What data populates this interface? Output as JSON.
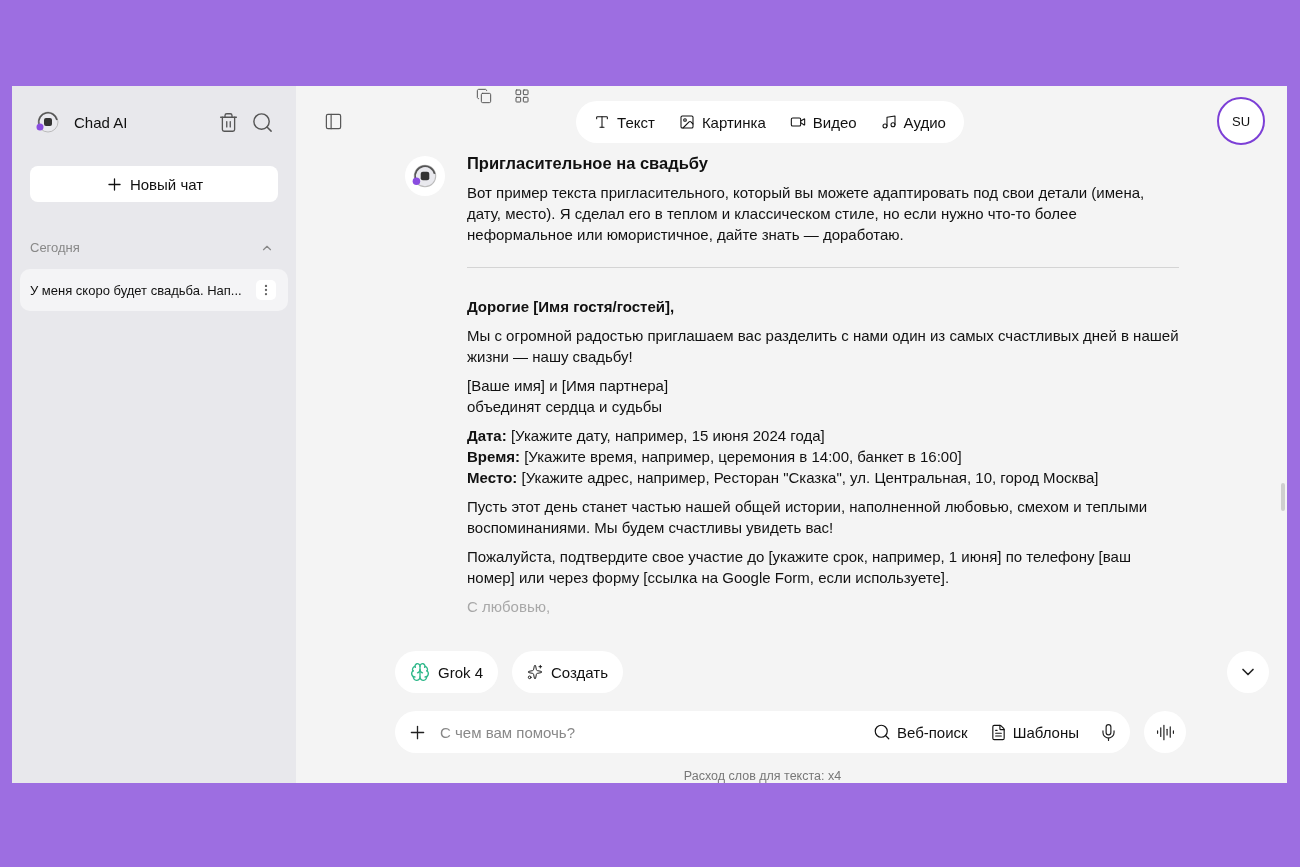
{
  "sidebar": {
    "brand": "Chad AI",
    "new_chat": "Новый чат",
    "section": {
      "title": "Сегодня",
      "expanded": true
    },
    "chats": [
      {
        "title": "У меня скоро будет свадьба. Нап...",
        "selected": true
      }
    ]
  },
  "mode_tabs": [
    {
      "label": "Текст",
      "kind": "text"
    },
    {
      "label": "Картинка",
      "kind": "image"
    },
    {
      "label": "Видео",
      "kind": "video"
    },
    {
      "label": "Аудио",
      "kind": "audio"
    }
  ],
  "avatar": "SU",
  "message": {
    "title": "Пригласительное на свадьбу",
    "intro": "Вот пример текста пригласительного, который вы можете адаптировать под свои детали (имена, дату, место). Я сделал его в теплом и классическом стиле, но если нужно что-то более неформальное или юмористичное, дайте знать — доработаю.",
    "blocks": [
      {
        "kind": "greeting",
        "lines": [
          "Дорогие [Имя гостя/гостей],"
        ]
      },
      {
        "kind": "text",
        "lines": [
          "Мы с огромной радостью приглашаем вас разделить с нами один из самых счастливых дней в нашей жизни — нашу свадьбу!"
        ]
      },
      {
        "kind": "text",
        "lines": [
          "[Ваше имя] и [Имя партнера]",
          "объединят сердца и судьбы"
        ]
      },
      {
        "kind": "text",
        "lines": [
          "**Дата:** [Укажите дату, например, 15 июня 2024 года]",
          "**Время:** [Укажите время, например, церемония в 14:00, банкет в 16:00]",
          "**Место:** [Укажите адрес, например, Ресторан \"Сказка\", ул. Центральная, 10, город Москва]"
        ]
      },
      {
        "kind": "text",
        "lines": [
          "Пусть этот день станет частью нашей общей истории, наполненной любовью, смехом и теплыми воспоминаниями. Мы будем счастливы увидеть вас!"
        ]
      },
      {
        "kind": "text",
        "lines": [
          "Пожалуйста, подтвердите свое участие до [укажите срок, например, 1 июня] по телефону [ваш номер] или через форму [ссылка на Google Form, если используете]."
        ]
      },
      {
        "kind": "faded",
        "lines": [
          "С любовью,"
        ]
      }
    ]
  },
  "model": "Grok 4",
  "create": "Создать",
  "composer": {
    "placeholder": "С чем вам помочь?",
    "tools": [
      {
        "label": "Веб-поиск",
        "kind": "search"
      },
      {
        "label": "Шаблоны",
        "kind": "templates"
      }
    ]
  },
  "footer": "Расход слов для текста: x4"
}
